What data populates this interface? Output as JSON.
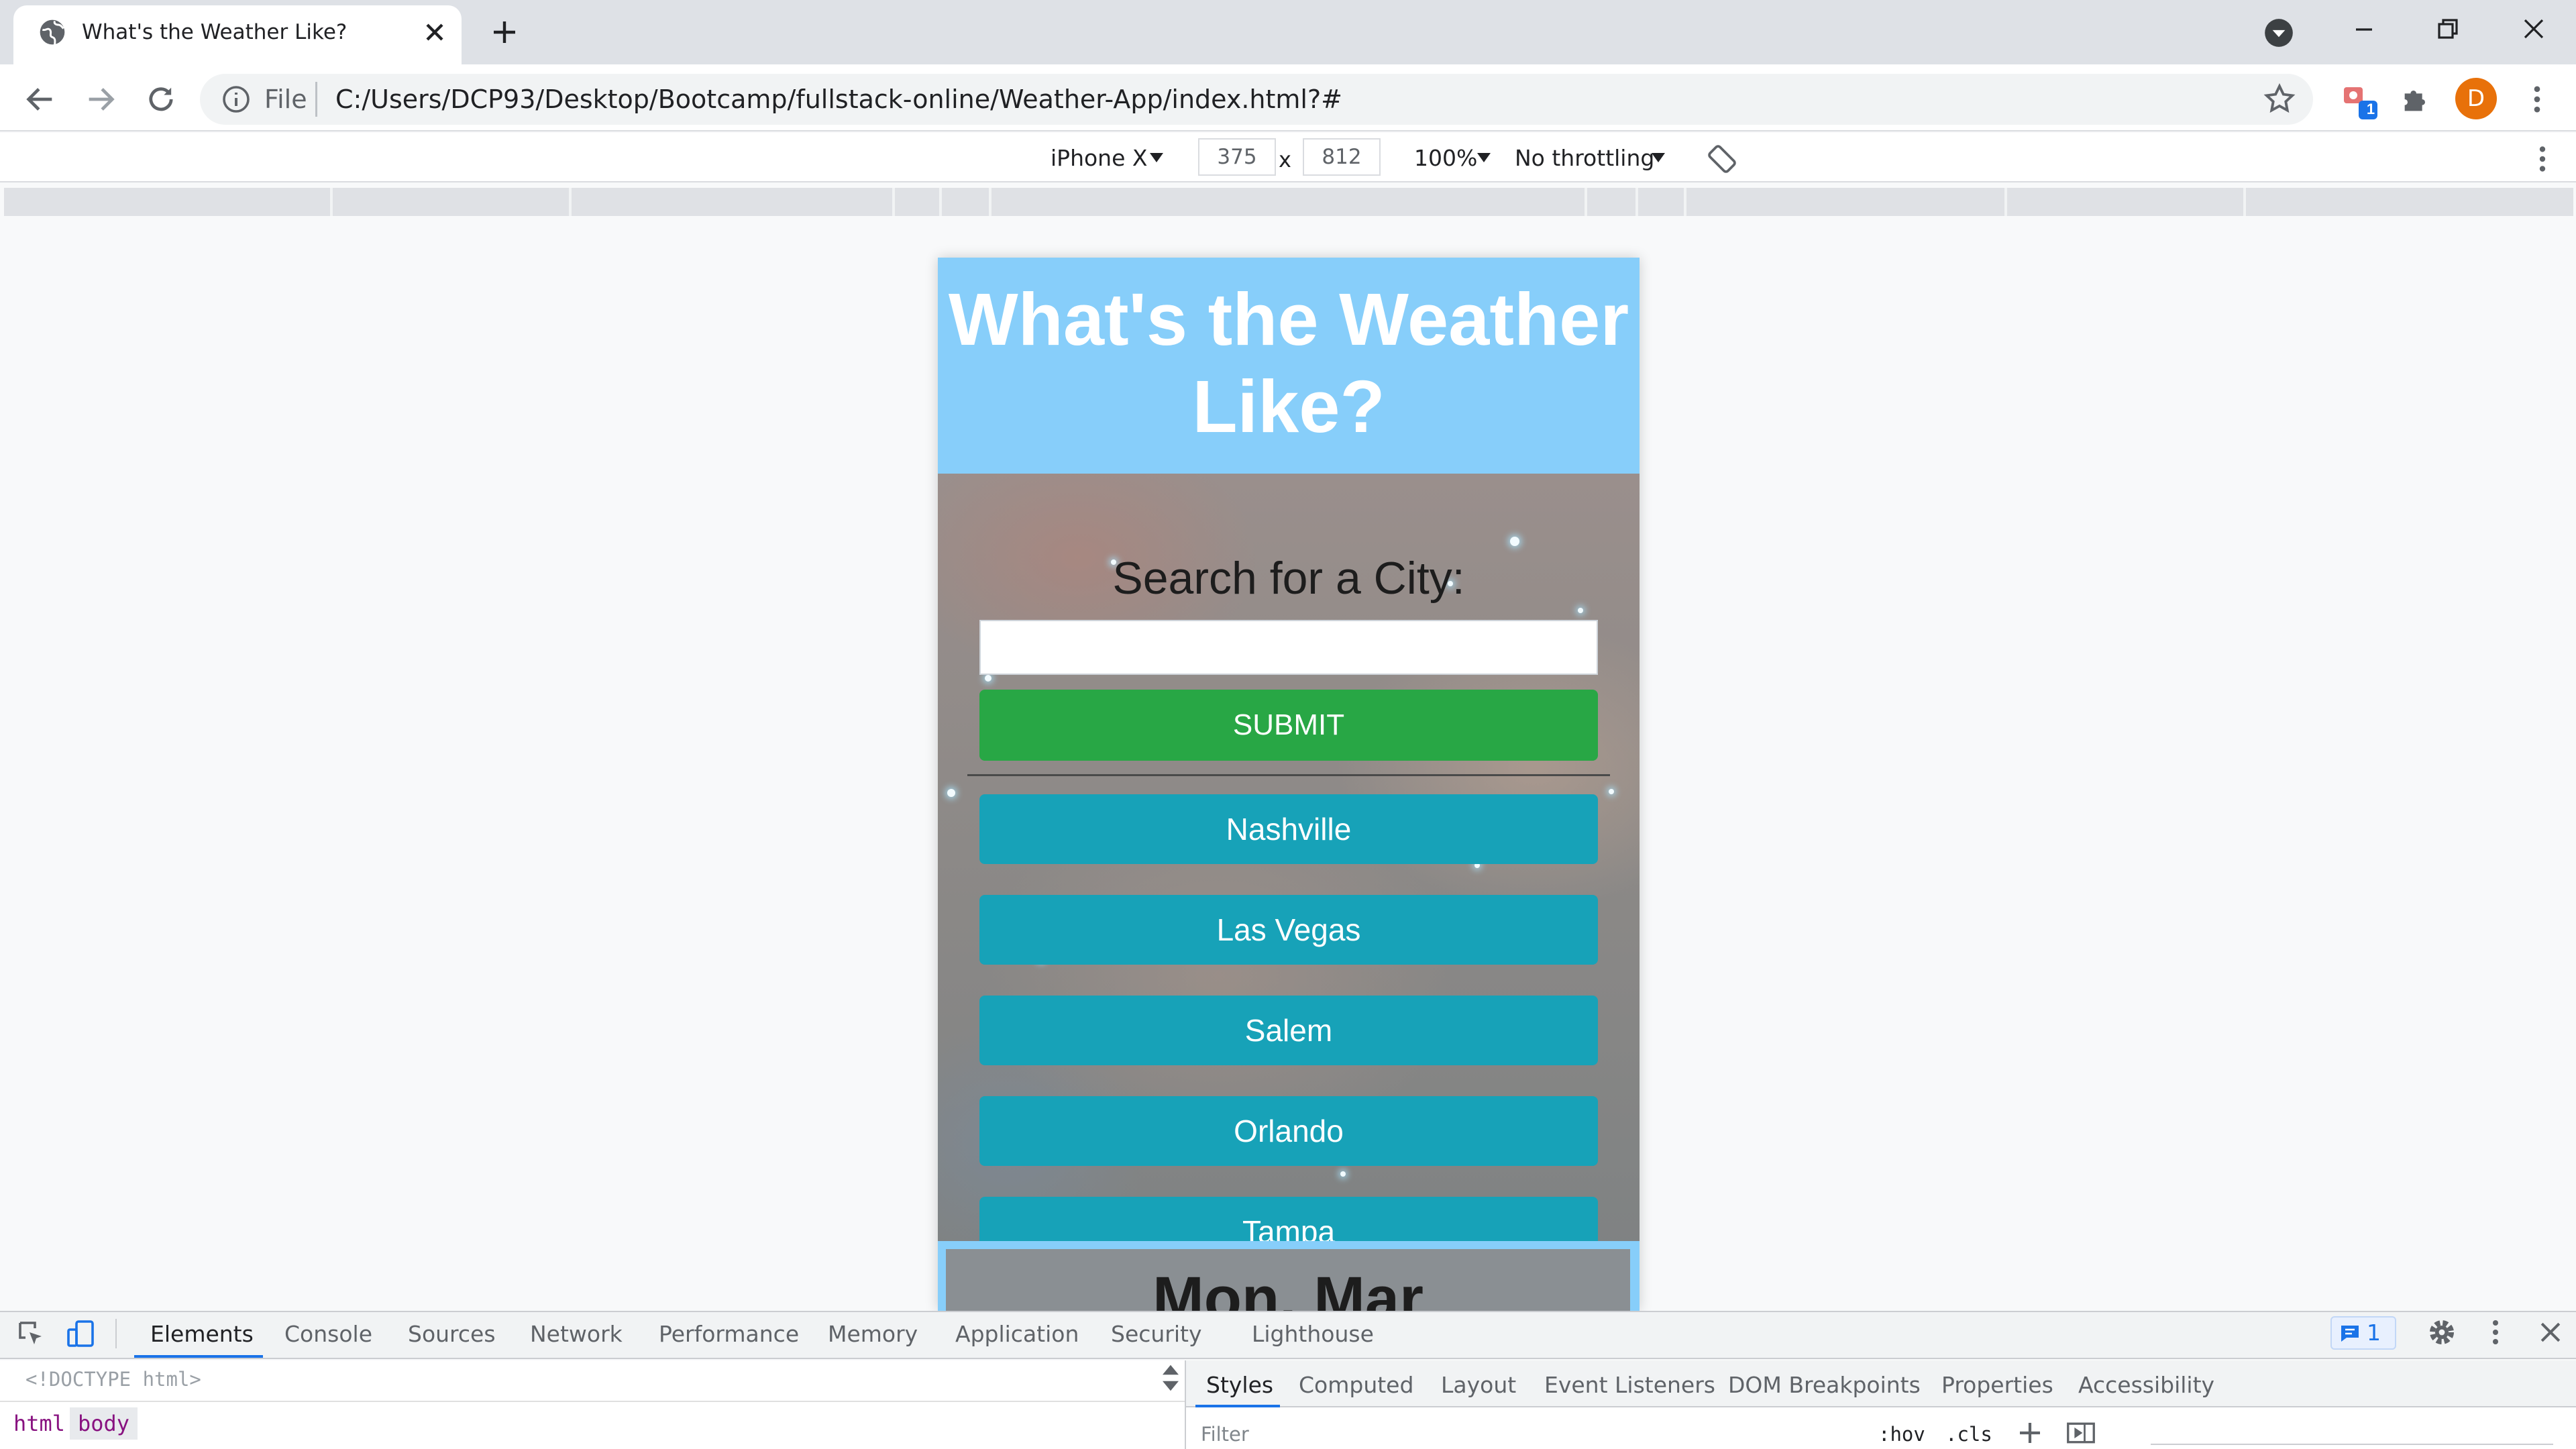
{
  "browser": {
    "tab_title": "What's the Weather Like?",
    "url_scheme": "File",
    "url": "C:/Users/DCP93/Desktop/Bootcamp/fullstack-online/Weather-App/index.html?#",
    "profile_initial": "D",
    "extension_badge": "1",
    "accent_color": "#1a73e8"
  },
  "device_toolbar": {
    "device": "iPhone X",
    "width": "375",
    "times": "x",
    "height": "812",
    "zoom": "100%",
    "throttling": "No throttling"
  },
  "app": {
    "title": "What's the Weather Like?",
    "header_color": "#87cefa",
    "search_label": "Search for a City:",
    "search_value": "",
    "submit_label": "SUBMIT",
    "submit_color": "#28a745",
    "city_color": "#17a2b8",
    "cities": [
      "Nashville",
      "Las Vegas",
      "Salem",
      "Orlando",
      "Tampa"
    ],
    "next_section_title": "Mon. Mar"
  },
  "devtools": {
    "tabs": [
      "Elements",
      "Console",
      "Sources",
      "Network",
      "Performance",
      "Memory",
      "Application",
      "Security",
      "Lighthouse"
    ],
    "active_tab": "Elements",
    "issues_count": "1",
    "doctype": "<!DOCTYPE html>",
    "breadcrumbs": [
      "html",
      "body"
    ],
    "side_tabs": [
      "Styles",
      "Computed",
      "Layout",
      "Event Listeners",
      "DOM Breakpoints",
      "Properties",
      "Accessibility"
    ],
    "filter_placeholder": "Filter",
    "hov_label": ":hov",
    "cls_label": ".cls"
  }
}
